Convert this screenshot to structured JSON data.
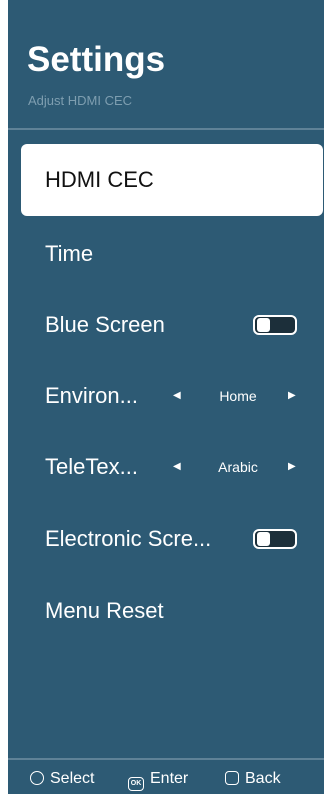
{
  "header": {
    "title": "Settings",
    "subtitle": "Adjust HDMI CEC"
  },
  "menu": {
    "items": [
      {
        "label": "HDMI CEC",
        "selected": true
      },
      {
        "label": "Time"
      },
      {
        "label": "Blue Screen",
        "control": "toggle",
        "value": false
      },
      {
        "label": "Environ...",
        "control": "selector",
        "value": "Home"
      },
      {
        "label": "TeleTex...",
        "control": "selector",
        "value": "Arabic"
      },
      {
        "label": "Electronic Scre...",
        "control": "toggle",
        "value": false
      },
      {
        "label": "Menu Reset"
      }
    ]
  },
  "footer": {
    "select_label": "Select",
    "enter_label": "Enter",
    "back_label": "Back",
    "ok_icon_text": "OK"
  },
  "colors": {
    "background": "#2d5a74",
    "selected_bg": "#ffffff",
    "text": "#ffffff",
    "subtitle": "#7e9eb0"
  },
  "icons": {
    "select": "select-icon",
    "enter": "ok-button-icon",
    "back": "back-icon",
    "left_arrow": "triangle-left-icon",
    "right_arrow": "triangle-right-icon"
  }
}
